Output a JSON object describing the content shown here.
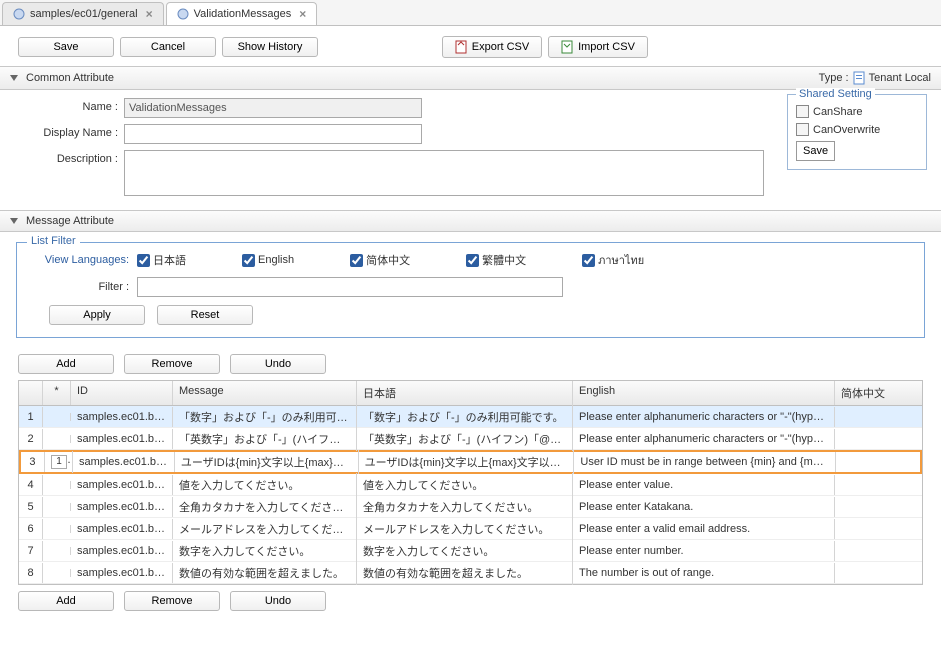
{
  "tabs": [
    {
      "label": "samples/ec01/general",
      "active": false
    },
    {
      "label": "ValidationMessages",
      "active": true
    }
  ],
  "toolbar": {
    "save": "Save",
    "cancel": "Cancel",
    "history": "Show History",
    "export": "Export CSV",
    "import": "Import CSV"
  },
  "commonAttr": {
    "title": "Common Attribute",
    "typeLabel": "Type :",
    "typeValue": "Tenant Local",
    "nameLabel": "Name :",
    "nameValue": "ValidationMessages",
    "displayLabel": "Display Name :",
    "displayValue": "",
    "descLabel": "Description :",
    "descValue": ""
  },
  "shared": {
    "legend": "Shared Setting",
    "canShare": "CanShare",
    "canOverwrite": "CanOverwrite",
    "save": "Save"
  },
  "messageAttr": {
    "title": "Message Attribute"
  },
  "filter": {
    "legend": "List Filter",
    "viewLabel": "View Languages:",
    "langs": [
      "日本語",
      "English",
      "简体中文",
      "繁體中文",
      "ภาษาไทย"
    ],
    "filterLabel": "Filter :",
    "filterValue": "",
    "apply": "Apply",
    "reset": "Reset"
  },
  "crud": {
    "add": "Add",
    "remove": "Remove",
    "undo": "Undo"
  },
  "grid": {
    "headers": {
      "star": "*",
      "id": "ID",
      "msg": "Message",
      "ja": "日本語",
      "en": "English",
      "zh": "简体中文"
    },
    "rows": [
      {
        "n": "1",
        "star": "",
        "id": "samples.ec01.be…",
        "msg": "「数字」および「-」のみ利用可…",
        "ja": "「数字」および「-」のみ利用可能です。",
        "en": "Please enter alphanumeric characters or \"-\"(hype…",
        "sel": true,
        "hl": false
      },
      {
        "n": "2",
        "star": "",
        "id": "samples.ec01.be…",
        "msg": "「英数字」および「-」(ハイフン)…",
        "ja": "「英数字」および「-」(ハイフン)「@」…",
        "en": "Please enter alphanumeric characters or \"-\"(hype…",
        "sel": false,
        "hl": false
      },
      {
        "n": "3",
        "star": "1",
        "id": "samples.ec01.be…",
        "msg": "ユーザIDは{min}文字以上{max}文…",
        "ja": "ユーザIDは{min}文字以上{max}文字以下…",
        "en": "User ID must be in range between {min} and {ma…",
        "sel": false,
        "hl": true
      },
      {
        "n": "4",
        "star": "",
        "id": "samples.ec01.be…",
        "msg": "値を入力してください。",
        "ja": "値を入力してください。",
        "en": "Please enter value.",
        "sel": false,
        "hl": false
      },
      {
        "n": "5",
        "star": "",
        "id": "samples.ec01.be…",
        "msg": "全角カタカナを入力してください。",
        "ja": "全角カタカナを入力してください。",
        "en": "Please enter Katakana.",
        "sel": false,
        "hl": false
      },
      {
        "n": "6",
        "star": "",
        "id": "samples.ec01.be…",
        "msg": "メールアドレスを入力してくださ…",
        "ja": "メールアドレスを入力してください。",
        "en": "Please enter a valid email address.",
        "sel": false,
        "hl": false
      },
      {
        "n": "7",
        "star": "",
        "id": "samples.ec01.be…",
        "msg": "数字を入力してください。",
        "ja": "数字を入力してください。",
        "en": "Please enter number.",
        "sel": false,
        "hl": false
      },
      {
        "n": "8",
        "star": "",
        "id": "samples.ec01.be…",
        "msg": "数値の有効な範囲を超えました。",
        "ja": "数値の有効な範囲を超えました。",
        "en": "The number is out of range.",
        "sel": false,
        "hl": false
      }
    ]
  }
}
